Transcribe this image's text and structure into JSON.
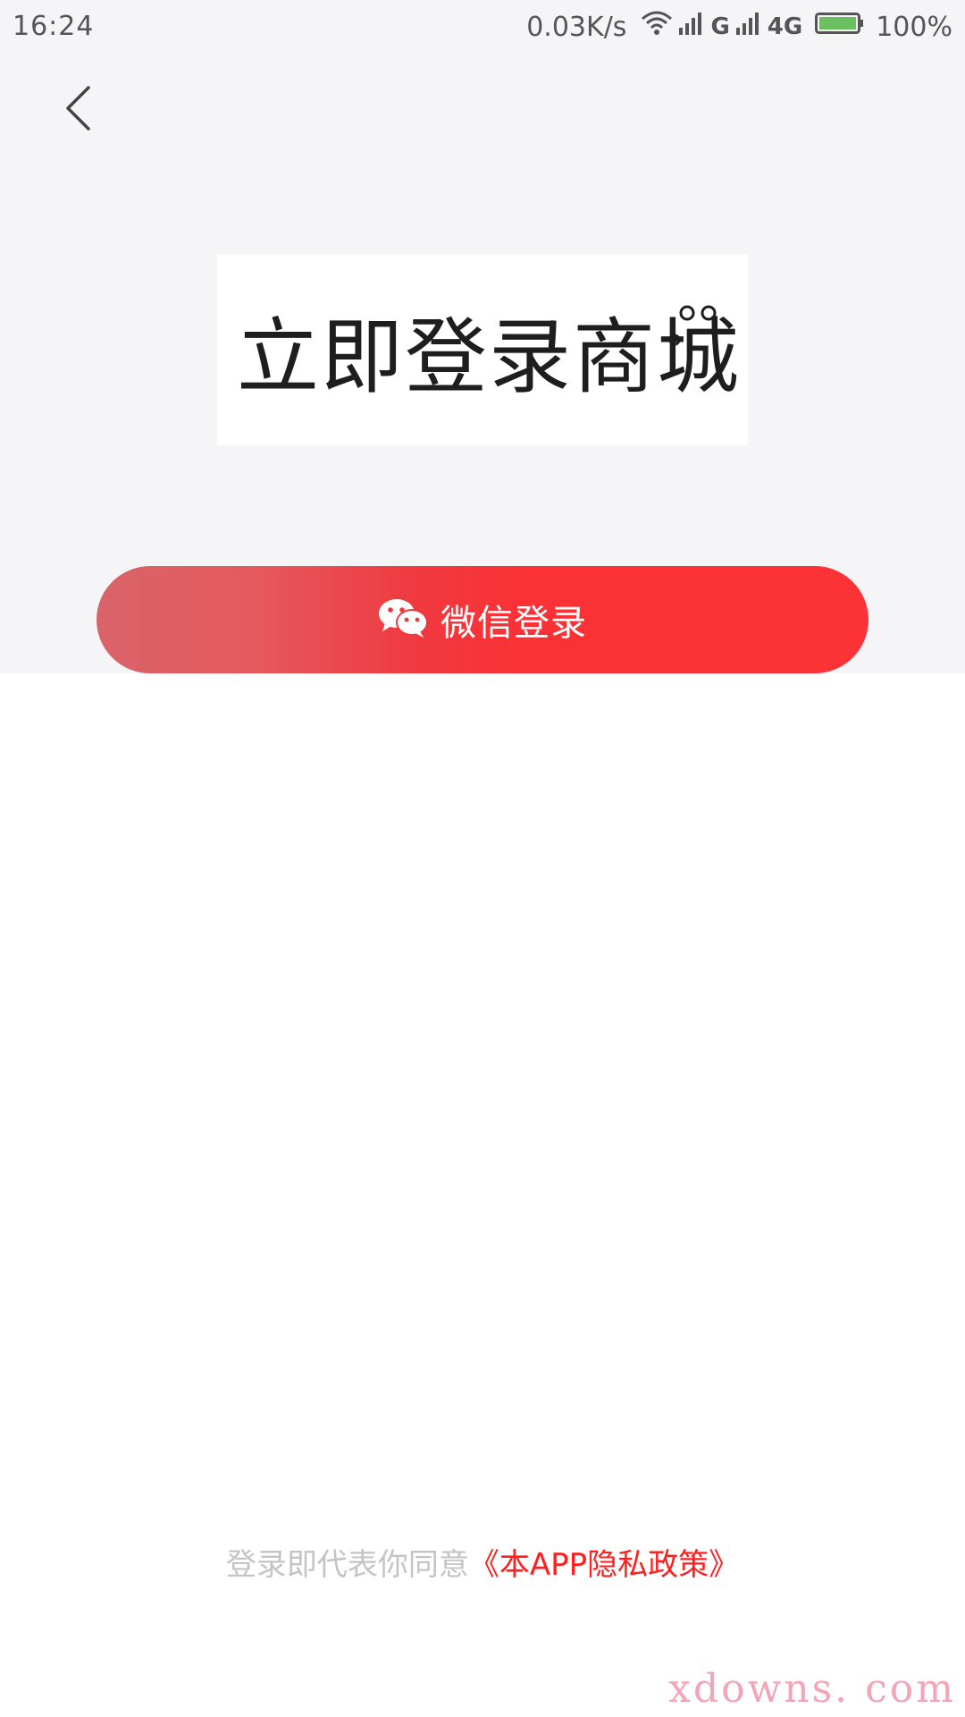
{
  "status_bar": {
    "time": "16:24",
    "net_speed": "0.03K/s",
    "sim1_label": "G",
    "sim2_label": "4G",
    "battery": "100%",
    "icons": [
      "wifi-icon",
      "signal-icon",
      "signal-icon",
      "battery-icon"
    ]
  },
  "header": {
    "back_icon": "chevron-left-icon"
  },
  "logo": {
    "text": "立即登录商城"
  },
  "login": {
    "wechat_label": "微信登录",
    "wechat_icon": "wechat-icon"
  },
  "agreement": {
    "prefix": "登录即代表你同意",
    "policy": "《本APP隐私政策》"
  },
  "watermark": "xdowns. com",
  "colors": {
    "background_top": "#f5f5f7",
    "background": "#ffffff",
    "accent": "#fb3337",
    "button_gradient_start": "#d9646a",
    "link": "#ff1f1f",
    "muted_text": "#c4c4c4",
    "battery_fill": "#6abf5e"
  }
}
